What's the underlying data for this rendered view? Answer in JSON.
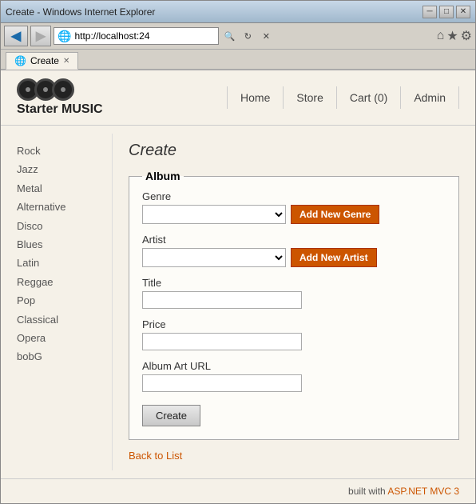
{
  "window": {
    "title": "Create - Windows Internet Explorer",
    "minimize_label": "─",
    "restore_label": "□",
    "close_label": "✕"
  },
  "address_bar": {
    "url": "http://localhost:24",
    "placeholder": "http://localhost:24"
  },
  "tab": {
    "label": "Create",
    "icon": "🌐"
  },
  "toolbar_icons": {
    "home": "⌂",
    "favorites": "★",
    "settings": "⚙"
  },
  "nav_buttons": {
    "back": "◀",
    "forward": "▶",
    "search": "🔍",
    "refresh": "↻",
    "stop": "✕"
  },
  "site": {
    "title": "Starter MUSIC",
    "nav": [
      {
        "label": "Home"
      },
      {
        "label": "Store"
      },
      {
        "label": "Cart (0)"
      },
      {
        "label": "Admin"
      }
    ]
  },
  "sidebar": {
    "links": [
      "Rock",
      "Jazz",
      "Metal",
      "Alternative",
      "Disco",
      "Blues",
      "Latin",
      "Reggae",
      "Pop",
      "Classical",
      "Opera",
      "bobG"
    ]
  },
  "page": {
    "title": "Create",
    "form": {
      "legend": "Album",
      "genre_label": "Genre",
      "genre_placeholder": "",
      "add_genre_btn": "Add New Genre",
      "artist_label": "Artist",
      "artist_placeholder": "",
      "add_artist_btn": "Add New Artist",
      "title_label": "Title",
      "price_label": "Price",
      "album_art_label": "Album Art URL",
      "create_btn": "Create"
    },
    "back_link": "Back to List"
  },
  "footer": {
    "text": "built with ",
    "highlight": "ASP.NET MVC 3"
  }
}
